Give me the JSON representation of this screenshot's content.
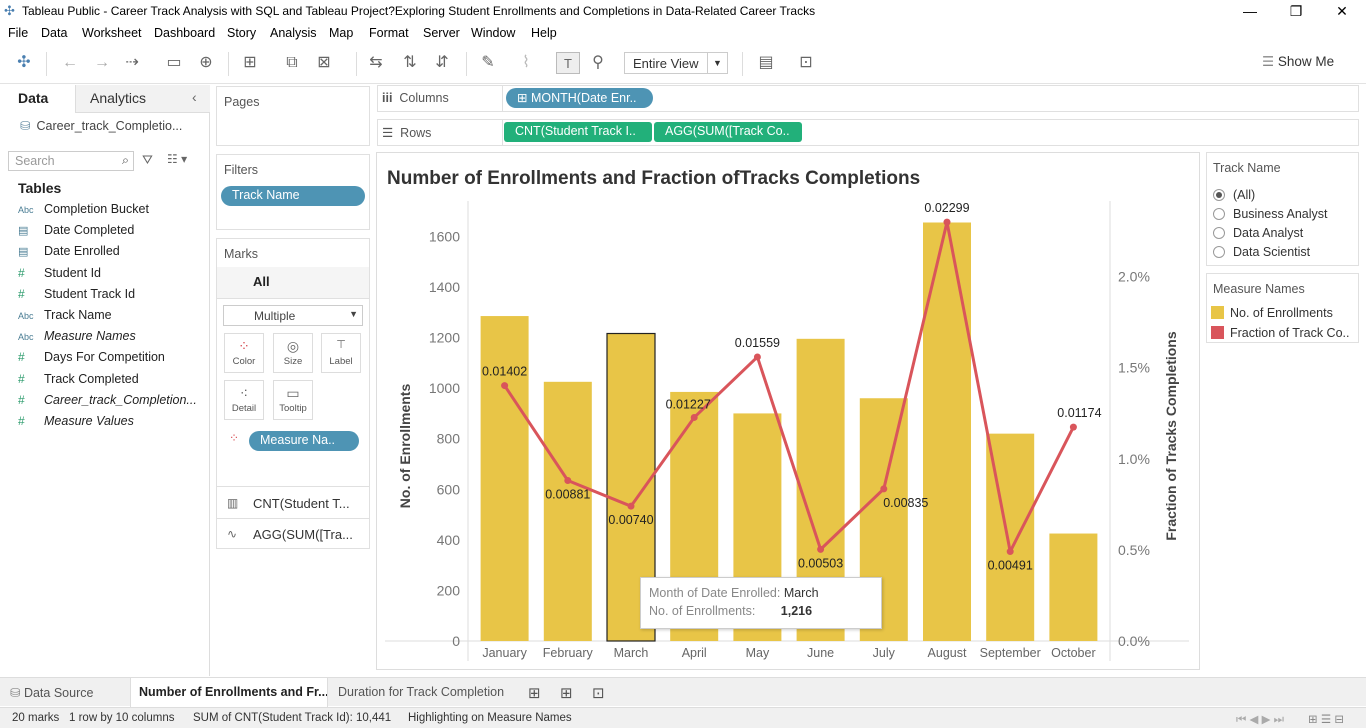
{
  "window": {
    "title": "Tableau Public - Career Track Analysis with SQL and Tableau Project?Exploring Student Enrollments and Completions in Data-Related Career Tracks",
    "controls": [
      "—",
      "❐",
      "✕"
    ]
  },
  "menu": [
    "File",
    "Data",
    "Worksheet",
    "Dashboard",
    "Story",
    "Analysis",
    "Map",
    "Format",
    "Server",
    "Window",
    "Help"
  ],
  "toolbar": {
    "fit_mode": "Entire View",
    "show_me": "Show Me"
  },
  "data_pane": {
    "tabs": {
      "data": "Data",
      "analytics": "Analytics"
    },
    "datasource": "Career_track_Completio...",
    "search_placeholder": "Search",
    "tables_heading": "Tables",
    "fields": [
      {
        "type": "Abc",
        "name": "Completion Bucket"
      },
      {
        "type": "date",
        "name": "Date Completed"
      },
      {
        "type": "date",
        "name": "Date Enrolled"
      },
      {
        "type": "#",
        "name": "Student Id"
      },
      {
        "type": "#",
        "name": "Student Track Id"
      },
      {
        "type": "Abc",
        "name": "Track Name"
      },
      {
        "type": "Abc",
        "name": "Measure Names",
        "italic": true
      },
      {
        "type": "#",
        "name": "Days For Competition"
      },
      {
        "type": "#",
        "name": "Track Completed"
      },
      {
        "type": "#",
        "name": "Career_track_Completion...",
        "italic": true
      },
      {
        "type": "#",
        "name": "Measure Values",
        "italic": true
      }
    ]
  },
  "cards": {
    "pages": "Pages",
    "filters": "Filters",
    "filter_pill": "Track Name",
    "marks": "Marks",
    "marks_all": "All",
    "mark_type": "Multiple",
    "mark_buttons": {
      "color": "Color",
      "size": "Size",
      "label": "Label",
      "detail": "Detail",
      "tooltip": "Tooltip"
    },
    "color_pill": "Measure Na..",
    "measure_1": "CNT(Student T...",
    "measure_2": "AGG(SUM([Tra..."
  },
  "shelves": {
    "columns_label": "Columns",
    "rows_label": "Rows",
    "columns_pill": "MONTH(Date Enr..",
    "rows_pill_1": "CNT(Student Track I..",
    "rows_pill_2": "AGG(SUM([Track Co.."
  },
  "colors": {
    "bar": "#e8c547",
    "line": "#d9555b",
    "pill_blue": "#4e94b4",
    "pill_green": "#22b07a"
  },
  "chart_data": {
    "type": "bar",
    "title": "Number of Enrollments and Fraction ofTracks Completions",
    "categories": [
      "January",
      "February",
      "March",
      "April",
      "May",
      "June",
      "July",
      "August",
      "September",
      "October"
    ],
    "series": [
      {
        "name": "No. of Enrollments",
        "axis": "left",
        "type": "bar",
        "values": [
          1285,
          1025,
          1216,
          985,
          900,
          1195,
          960,
          1655,
          820,
          425
        ]
      },
      {
        "name": "Fraction of Track Co..",
        "axis": "right",
        "type": "line",
        "values": [
          0.01402,
          0.00881,
          0.0074,
          0.01227,
          0.01559,
          0.00503,
          0.00835,
          0.02299,
          0.00491,
          0.01174
        ],
        "labels": [
          "0.01402",
          "0.00881",
          "0.00740",
          "0.01227",
          "0.01559",
          "0.00503",
          "0.00835",
          "0.02299",
          "0.00491",
          "0.01174"
        ]
      }
    ],
    "ylabel": "No. of Enrollments",
    "ylim": [
      0,
      1740
    ],
    "yticks": [
      0,
      200,
      400,
      600,
      800,
      1000,
      1200,
      1400,
      1600
    ],
    "y2label": "Fraction of Tracks Completions",
    "y2lim": [
      0,
      0.02415
    ],
    "y2ticks": [
      0,
      0.005,
      0.01,
      0.015,
      0.02
    ],
    "y2ticklabels": [
      "0.0%",
      "0.5%",
      "1.0%",
      "1.5%",
      "2.0%"
    ],
    "highlighted_index": 2
  },
  "tooltip": {
    "label1": "Month of Date Enrolled:",
    "value1": "March",
    "label2": "No. of Enrollments:",
    "value2": "1,216"
  },
  "legends": {
    "track_name": {
      "title": "Track Name",
      "options": [
        "(All)",
        "Business Analyst",
        "Data Analyst",
        "Data Scientist"
      ],
      "selected": 0
    },
    "measure_names": {
      "title": "Measure Names",
      "items": [
        "No. of Enrollments",
        "Fraction of Track Co.."
      ]
    }
  },
  "sheet_tabs": [
    "Data Source",
    "Number of Enrollments and Fr...",
    "Duration for Track Completion"
  ],
  "status": {
    "marks": "20 marks",
    "dims": "1 row by 10 columns",
    "sum": "SUM of CNT(Student Track Id): 10,441",
    "highlight": "Highlighting on Measure Names"
  }
}
